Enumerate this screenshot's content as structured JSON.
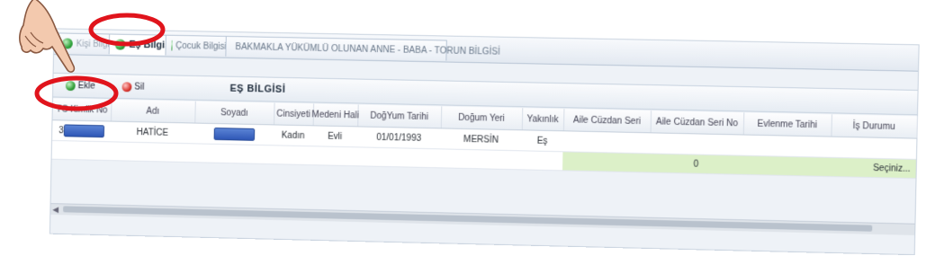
{
  "tabs": [
    {
      "label": "Kişi Bilgisi",
      "active": false
    },
    {
      "label": "Eş Bilgisi",
      "active": true
    },
    {
      "label": "Çocuk Bilgisi",
      "active": false
    },
    {
      "label": "BAKMAKLA YÜKÜMLÜ OLUNAN ANNE - BABA - TORUN BİLGİSİ",
      "active": false
    }
  ],
  "toolbar": {
    "add_label": "Ekle",
    "delete_label": "Sil",
    "section_title": "EŞ BİLGİSİ"
  },
  "table": {
    "headers": [
      "TC Kimlik No",
      "Adı",
      "Soyadı",
      "Cinsiyeti",
      "Medeni Hali",
      "DoğYum Tarihi",
      "Doğum Yeri",
      "Yakınlık",
      "Aile Cüzdan Seri",
      "Aile Cüzdan Seri No",
      "Evlenme Tarihi",
      "İş Durumu"
    ],
    "row": {
      "tc_prefix": "3",
      "adi": "HATİCE",
      "cinsiyeti": "Kadın",
      "medeni_hali": "Evli",
      "dogum_tarihi": "01/01/1993",
      "dogum_yeri": "MERSİN",
      "yakinlik": "Eş",
      "aile_cuzdan_seri_no": "0",
      "is_durumu": "Seçiniz..."
    }
  },
  "colors": {
    "annotation": "#e0141c",
    "redaction": "#3a62c3",
    "highlight": "#dcf0c8"
  },
  "icons": [
    "pointing-hand-icon",
    "refresh-green-icon",
    "add-icon",
    "delete-icon"
  ]
}
